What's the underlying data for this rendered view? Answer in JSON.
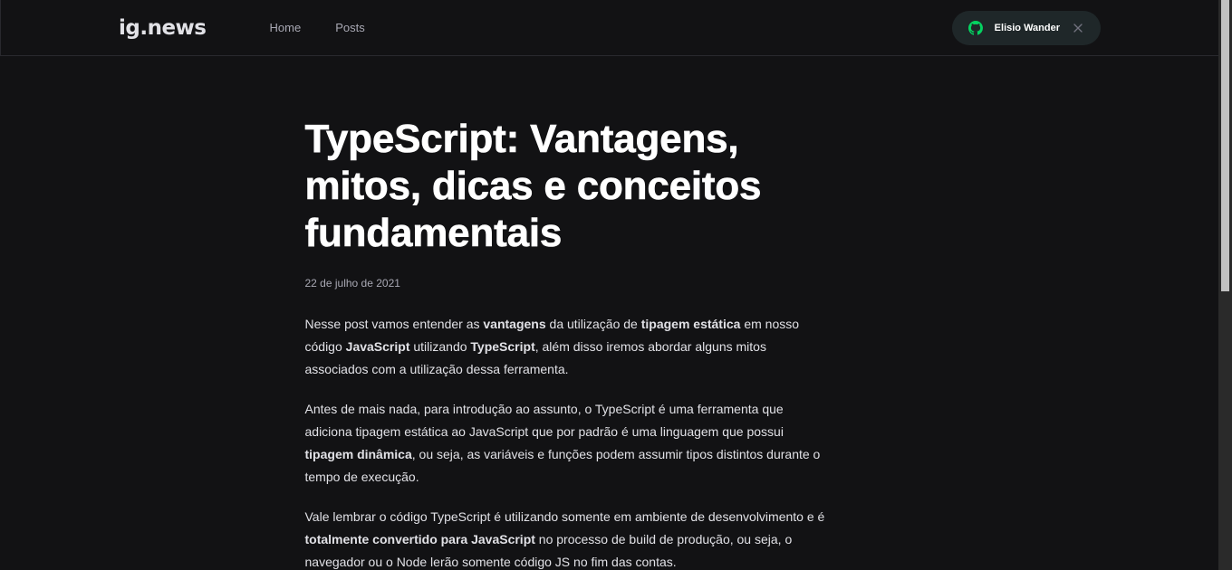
{
  "header": {
    "logo": "ig.news",
    "nav": [
      {
        "label": "Home"
      },
      {
        "label": "Posts"
      }
    ],
    "signin": {
      "user_name": "Elisio Wander",
      "icon": "github-icon",
      "close_icon": "close-icon"
    }
  },
  "post": {
    "title": "TypeScript: Vantagens, mitos, dicas e conceitos fundamentais",
    "date": "22 de julho de 2021",
    "paragraphs": [
      [
        {
          "text": "Nesse post vamos entender as ",
          "bold": false
        },
        {
          "text": "vantagens",
          "bold": true
        },
        {
          "text": " da utilização de ",
          "bold": false
        },
        {
          "text": "tipagem estática",
          "bold": true
        },
        {
          "text": " em nosso código ",
          "bold": false
        },
        {
          "text": "JavaScript",
          "bold": true
        },
        {
          "text": " utilizando ",
          "bold": false
        },
        {
          "text": "TypeScript",
          "bold": true
        },
        {
          "text": ", além disso iremos abordar alguns mitos associados com a utilização dessa ferramenta.",
          "bold": false
        }
      ],
      [
        {
          "text": "Antes de mais nada, para introdução ao assunto, o TypeScript é uma ferramenta que adiciona tipagem estática ao JavaScript que por padrão é uma linguagem que possui ",
          "bold": false
        },
        {
          "text": "tipagem dinâmica",
          "bold": true
        },
        {
          "text": ", ou seja, as variáveis e funções podem assumir tipos distintos durante o tempo de execução.",
          "bold": false
        }
      ],
      [
        {
          "text": "Vale lembrar o código TypeScript é utilizando somente em ambiente de desenvolvimento e é ",
          "bold": false
        },
        {
          "text": "totalmente convertido para JavaScript",
          "bold": true
        },
        {
          "text": " no processo de build de produção, ou seja, o navegador ou o Node lerão somente código JS no fim das contas.",
          "bold": false
        }
      ]
    ]
  },
  "colors": {
    "background": "#121214",
    "accent_github": "#04d361",
    "button_bg": "#1f2729",
    "text": "#e1e1e6",
    "muted": "#a8a8b3"
  }
}
